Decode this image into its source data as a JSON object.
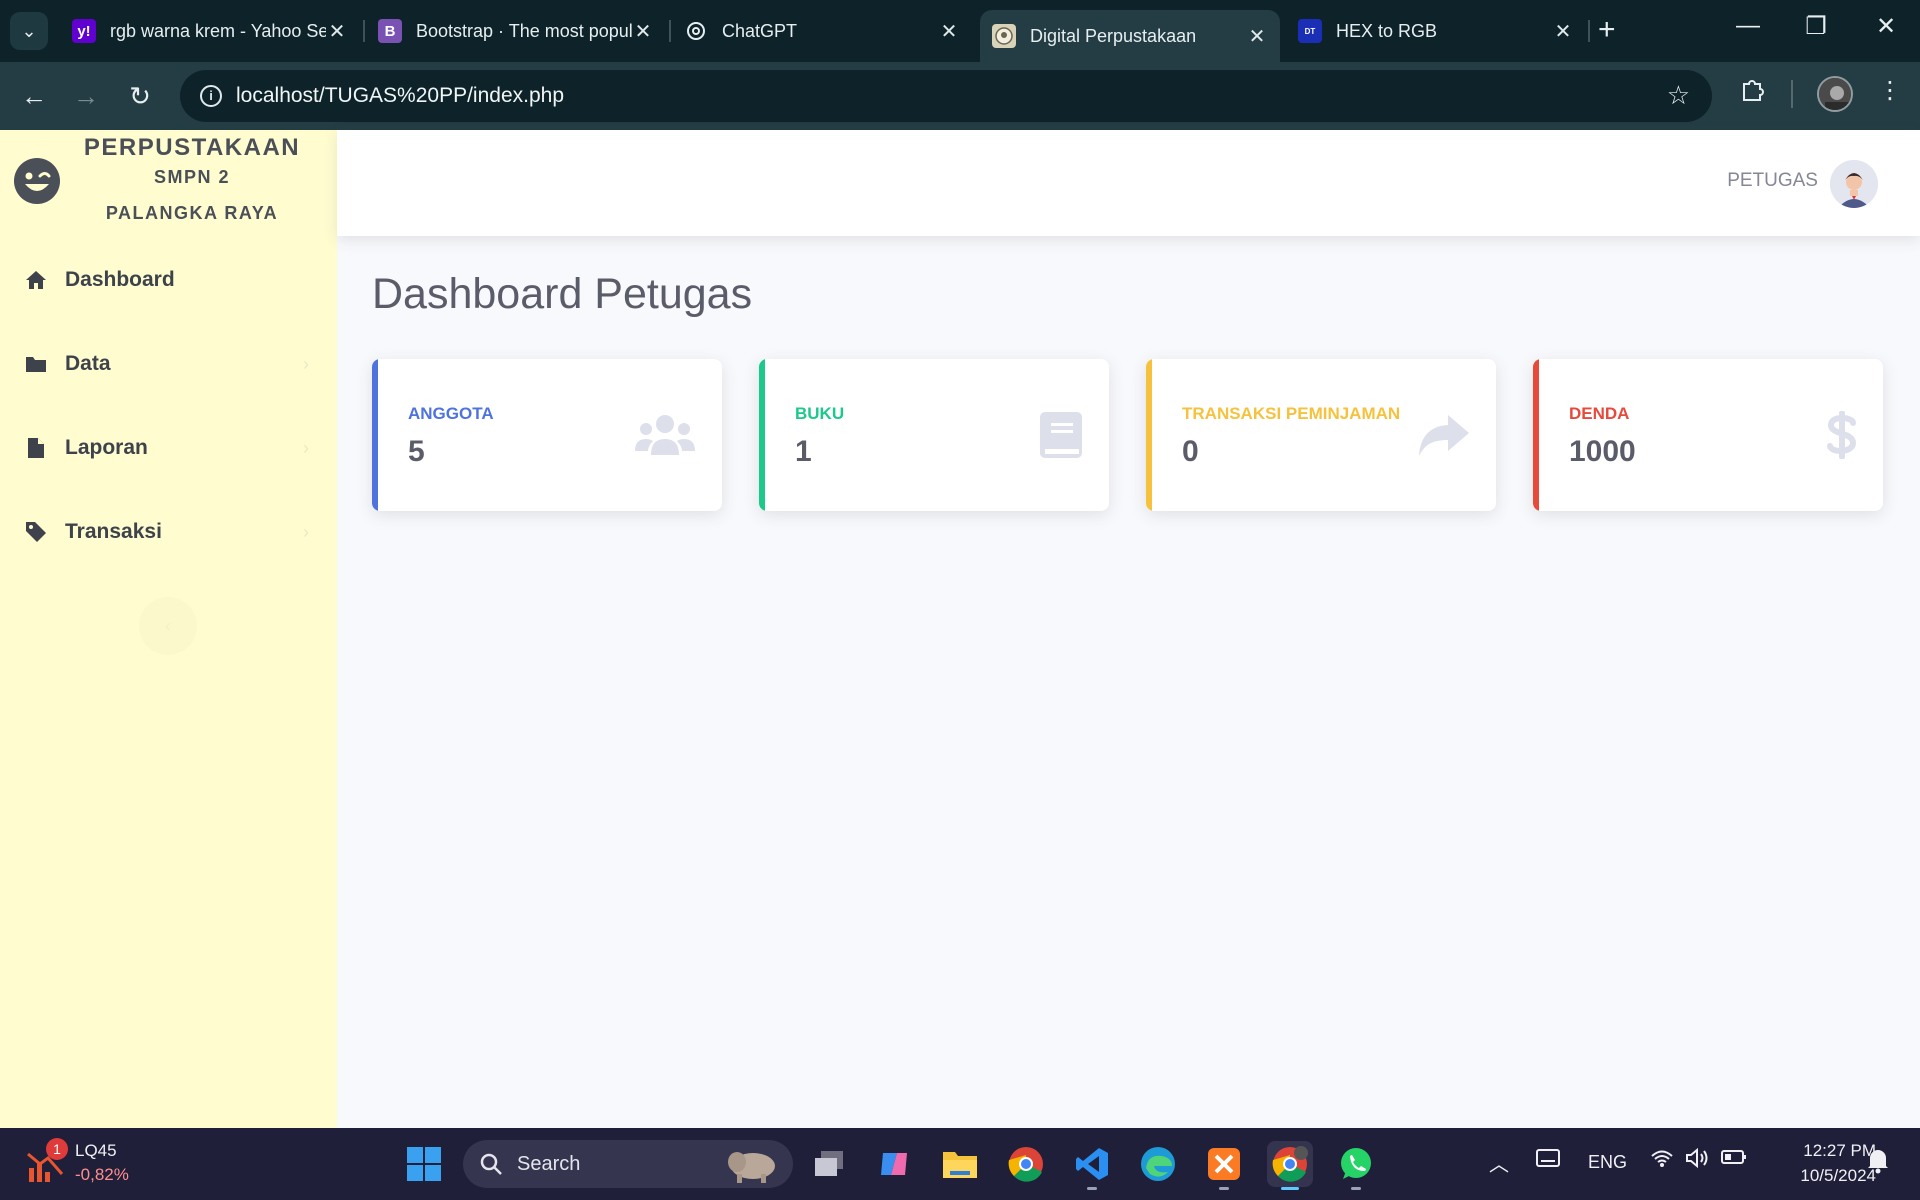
{
  "browser": {
    "tabs": [
      {
        "title": "rgb warna krem - Yahoo Search",
        "favicon": "yahoo-icon",
        "color": "#6001d2",
        "glyph": "y!"
      },
      {
        "title": "Bootstrap · The most popular",
        "favicon": "bootstrap-icon",
        "color": "#7952b3",
        "glyph": "B"
      },
      {
        "title": "ChatGPT",
        "favicon": "chatgpt-icon",
        "color": "#0e2329",
        "glyph": "⚙"
      },
      {
        "title": "Digital Perpustakaan",
        "favicon": "library-seal-icon",
        "color": "#d8d2b8",
        "glyph": "◉"
      },
      {
        "title": "HEX to RGB",
        "favicon": "danstools-icon",
        "color": "#1a2fb5",
        "glyph": "DT"
      }
    ],
    "url": "localhost/TUGAS%20PP/index.php"
  },
  "sidebar": {
    "brand_line1": "PERPUSTAKAAN",
    "brand_line2": "SMPN 2",
    "brand_line3": "PALANGKA RAYA",
    "items": [
      {
        "label": "Dashboard",
        "icon": "home-icon"
      },
      {
        "label": "Data",
        "icon": "folder-icon"
      },
      {
        "label": "Laporan",
        "icon": "file-icon"
      },
      {
        "label": "Transaksi",
        "icon": "tag-icon"
      }
    ]
  },
  "topbar": {
    "user_name": "PETUGAS"
  },
  "main": {
    "title": "Dashboard Petugas",
    "cards": [
      {
        "label": "ANGGOTA",
        "value": "5",
        "color": "#4e73df",
        "icon": "users-icon"
      },
      {
        "label": "BUKU",
        "value": "1",
        "color": "#1cc88a",
        "icon": "book-icon"
      },
      {
        "label": "TRANSAKSI PEMINJAMAN",
        "value": "0",
        "color": "#f6c23e",
        "icon": "share-arrow-icon"
      },
      {
        "label": "DENDA",
        "value": "1000",
        "color": "#e74a3b",
        "icon": "dollar-icon"
      }
    ]
  },
  "taskbar": {
    "stock_badge": "1",
    "stock_name": "LQ45",
    "stock_change": "-0,82%",
    "search_label": "Search",
    "language": "ENG",
    "time": "12:27 PM",
    "date": "10/5/2024"
  }
}
